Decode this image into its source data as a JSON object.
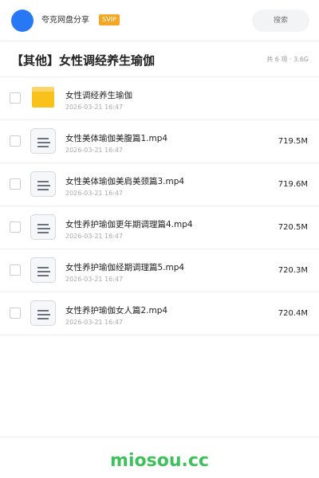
{
  "header": {
    "username": "夸克网盘分享",
    "badge": "SVIP",
    "search_placeholder": "搜索"
  },
  "title_row": {
    "title": "【其他】女性调经养生瑜伽",
    "summary": "共 6 项 · 3.6G"
  },
  "files": [
    {
      "type": "folder",
      "icon": "folder-icon",
      "name": "女性调经养生瑜伽",
      "date": "2026-03-21 16:47",
      "size": ""
    },
    {
      "type": "file",
      "icon": "file-icon",
      "name": "女性美体瑜伽美腹篇1.mp4",
      "date": "2026-03-21 16:47",
      "size": "719.5M"
    },
    {
      "type": "file",
      "icon": "file-icon",
      "name": "女性美体瑜伽美肩美颈篇3.mp4",
      "date": "2026-03-21 16:47",
      "size": "719.6M"
    },
    {
      "type": "file",
      "icon": "file-icon",
      "name": "女性养护瑜伽更年期调理篇4.mp4",
      "date": "2026-03-21 16:47",
      "size": "720.5M"
    },
    {
      "type": "file",
      "icon": "file-icon",
      "name": "女性养护瑜伽经期调理篇5.mp4",
      "date": "2026-03-21 16:47",
      "size": "720.3M"
    },
    {
      "type": "file",
      "icon": "file-icon",
      "name": "女性养护瑜伽女人篇2.mp4",
      "date": "2026-03-21 16:47",
      "size": "720.4M"
    }
  ],
  "footer": {
    "watermark": "miosou.cc"
  },
  "colors": {
    "avatar": "#2878f5",
    "badge": "#f5a623",
    "folder": "#f9c21b",
    "watermark": "#3ec05a"
  }
}
